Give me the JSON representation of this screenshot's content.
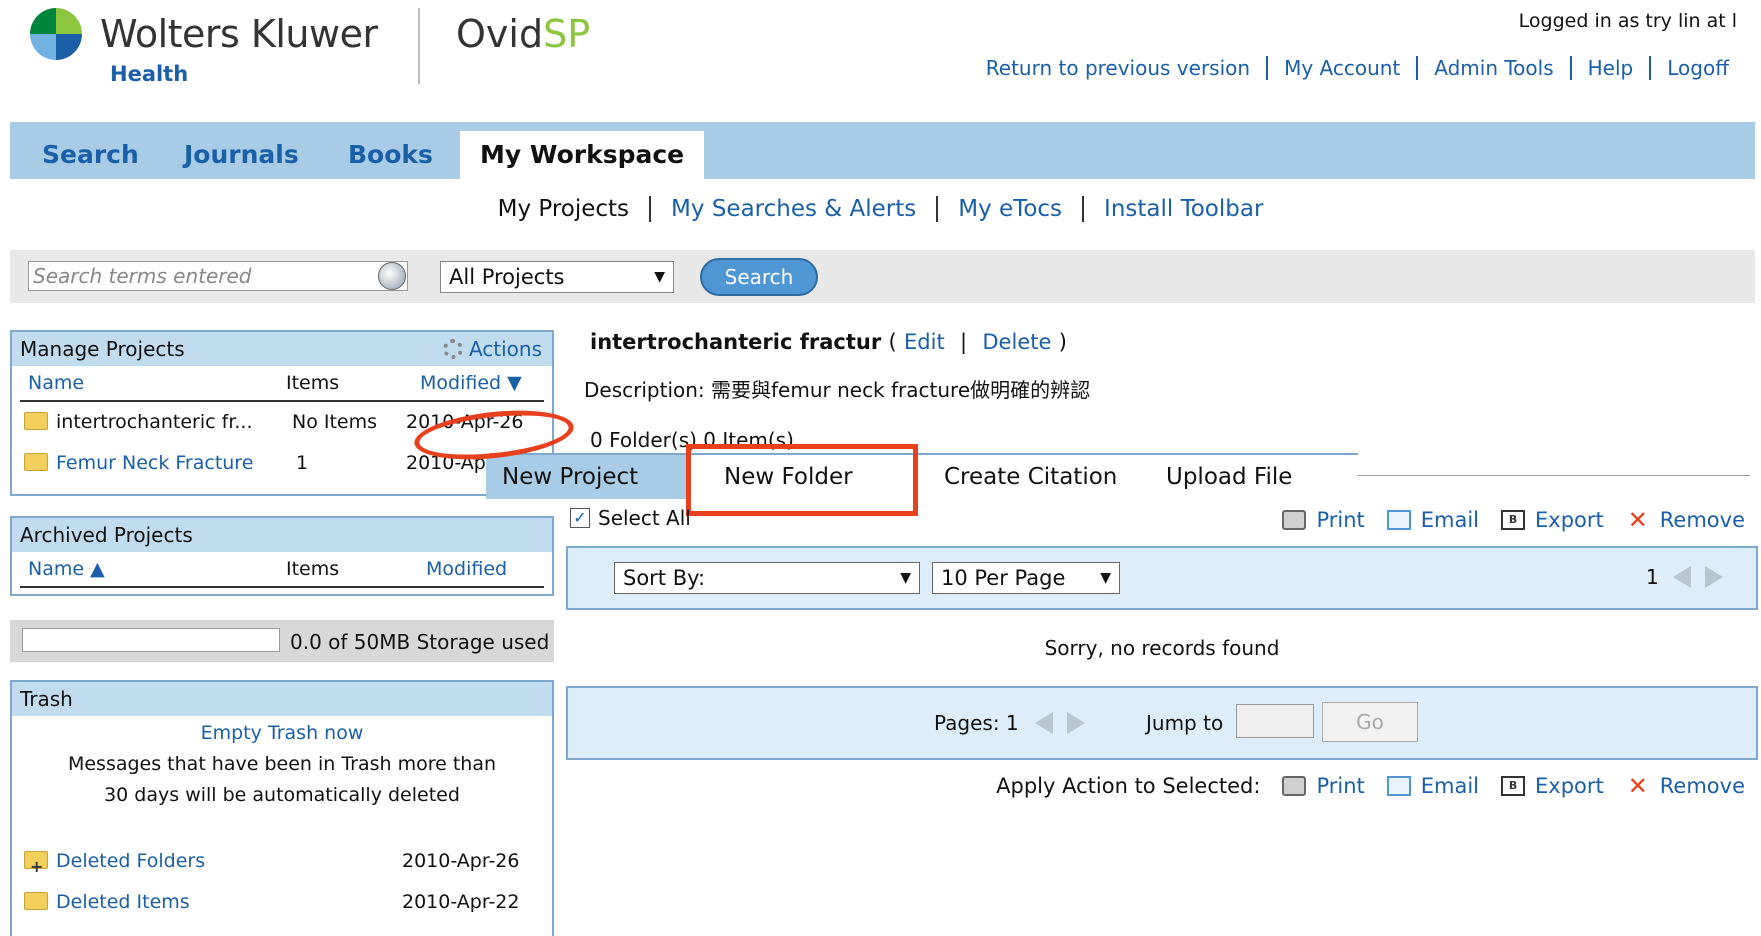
{
  "header": {
    "brand_name": "Wolters Kluwer",
    "brand_sub": "Health",
    "product_prefix": "Ovid",
    "product_suffix": "SP",
    "logged_in": "Logged in as try lin at l",
    "links": [
      "Return to previous version",
      "My Account",
      "Admin Tools",
      "Help",
      "Logoff"
    ]
  },
  "tabs": [
    "Search",
    "Journals",
    "Books",
    "My Workspace"
  ],
  "active_tab": "My Workspace",
  "subnav": [
    "My Projects",
    "My Searches & Alerts",
    "My eTocs",
    "Install Toolbar"
  ],
  "search": {
    "placeholder": "Search terms entered",
    "scope": "All Projects",
    "button": "Search"
  },
  "manage_projects": {
    "title": "Manage Projects",
    "actions": "Actions",
    "columns": [
      "Name",
      "Items",
      "Modified ▼"
    ],
    "rows": [
      {
        "name": "intertrochanteric fr...",
        "items": "No Items",
        "modified": "2010-Apr-26"
      },
      {
        "name": "Femur Neck Fracture",
        "items": "1",
        "modified": "2010-Apr"
      }
    ]
  },
  "archived_projects": {
    "title": "Archived Projects",
    "columns": [
      "Name ▲",
      "Items",
      "Modified"
    ]
  },
  "storage": {
    "text": "0.0 of 50MB Storage used",
    "used_fraction": 0
  },
  "trash": {
    "title": "Trash",
    "empty_link": "Empty Trash now",
    "message_line1": "Messages that have been in Trash more than",
    "message_line2": "30 days will be automatically deleted",
    "rows": [
      {
        "name": "Deleted Folders",
        "date": "2010-Apr-26"
      },
      {
        "name": "Deleted Items",
        "date": "2010-Apr-22"
      }
    ]
  },
  "project": {
    "title": "intertrochanteric fractur",
    "edit": "Edit",
    "delete": "Delete",
    "paren_open": "(",
    "separator": "|",
    "paren_close": ")",
    "description": "Description: 需要與femur neck fracture做明確的辨認",
    "count": "0 Folder(s) 0 Item(s)"
  },
  "toolbar": {
    "new_project": "New Project",
    "new_folder": "New Folder",
    "create_citation": "Create Citation",
    "upload_file": "Upload File"
  },
  "list": {
    "select_all": "Select All",
    "select_all_checked": true,
    "check_mark": "✓",
    "actions": [
      "Print",
      "Email",
      "Export",
      "Remove"
    ],
    "export_icon_text": "B",
    "remove_icon_glyph": "✕",
    "sort_by": "Sort By:",
    "per_page": "10 Per Page",
    "page_number": "1",
    "no_records": "Sorry, no records found",
    "pages_label": "Pages: 1",
    "jump_to": "Jump to",
    "go": "Go",
    "apply_action_label": "Apply Action to Selected:"
  },
  "colors": {
    "accent_blue": "#1a5fa8",
    "tab_bar": "#a9cce6",
    "highlight_red": "#e8401c",
    "panel_head": "#c2dcef"
  }
}
